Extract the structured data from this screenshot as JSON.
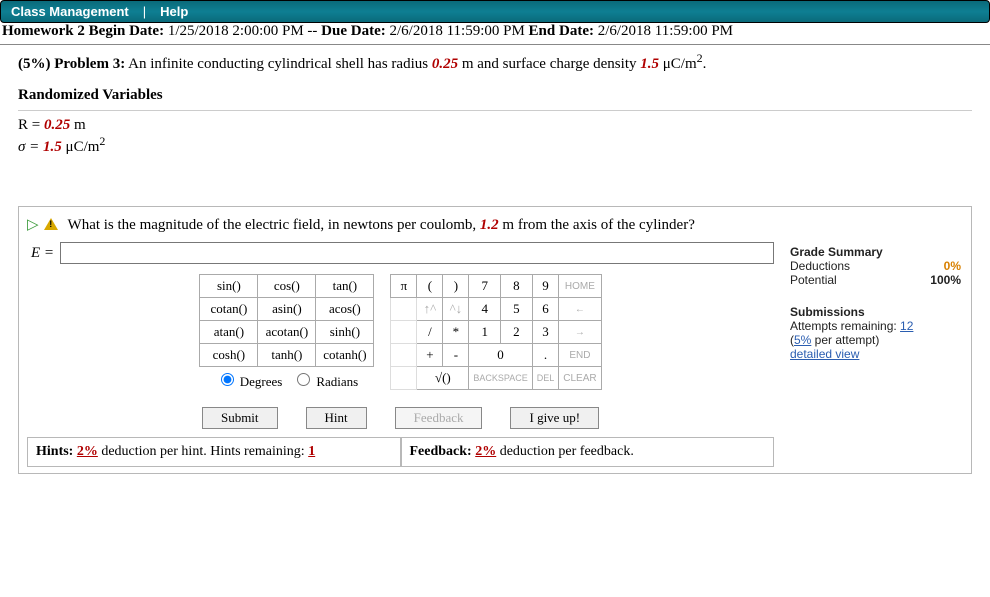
{
  "topbar": {
    "class_mgmt": "Class Management",
    "sep": "|",
    "help": "Help"
  },
  "dates": {
    "hw_label": "Homework 2",
    "begin_label": " Begin Date: ",
    "begin": "1/25/2018 2:00:00 PM",
    "dash": " -- ",
    "due_label": "Due Date: ",
    "due": "2/6/2018 11:59:00 PM ",
    "end_label": "End Date: ",
    "end": "2/6/2018 11:59:00 PM"
  },
  "problem": {
    "weight": "(5%) ",
    "label": "Problem 3:",
    "text1": " An infinite conducting cylindrical shell has radius ",
    "r": "0.25",
    "text2": " m and surface charge density ",
    "sigma": "1.5",
    "text3": " μC/m",
    "text4": "."
  },
  "rand_header": "Randomized Variables",
  "vars": {
    "r_lhs": "R = ",
    "r_val": "0.25",
    "r_unit": " m",
    "s_lhs": "σ = ",
    "s_val": "1.5",
    "s_unit": " μC/m"
  },
  "question": {
    "text1": "What is the magnitude of the electric field, in newtons per coulomb, ",
    "dist": "1.2",
    "text2": " m from the axis of the cylinder?"
  },
  "answer_label": "E = ",
  "fn": {
    "r0c0": "sin()",
    "r0c1": "cos()",
    "r0c2": "tan()",
    "r1c0": "cotan()",
    "r1c1": "asin()",
    "r1c2": "acos()",
    "r2c0": "atan()",
    "r2c1": "acotan()",
    "r2c2": "sinh()",
    "r3c0": "cosh()",
    "r3c1": "tanh()",
    "r3c2": "cotanh()",
    "deg": "Degrees",
    "rad": "Radians"
  },
  "num": {
    "pi": "π",
    "lp": "(",
    "rp": ")",
    "7": "7",
    "8": "8",
    "9": "9",
    "home": "HOME",
    "up": "↑^",
    "dn": "^↓",
    "4": "4",
    "5": "5",
    "6": "6",
    "left": "←",
    "sl": "/",
    "st": "*",
    "1": "1",
    "2": "2",
    "3": "3",
    "right": "→",
    "pl": "+",
    "mi": "-",
    "0": "0",
    "dot": ".",
    "end": "END",
    "sqrt": "√()",
    "bksp": "BACKSPACE",
    "del": "DEL",
    "clear": "CLEAR"
  },
  "actions": {
    "submit": "Submit",
    "hint": "Hint",
    "feedback": "Feedback",
    "giveup": "I give up!"
  },
  "footer": {
    "hints_pre": "Hints: ",
    "hints_pct": "2%",
    "hints_mid": " deduction per hint. Hints remaining: ",
    "hints_rem": "1",
    "fb_pre": "Feedback: ",
    "fb_pct": "2%",
    "fb_post": " deduction per feedback."
  },
  "side": {
    "grade_head": "Grade Summary",
    "ded_label": "Deductions",
    "ded_val": "0%",
    "pot_label": "Potential",
    "pot_val": "100%",
    "sub_head": "Submissions",
    "att_pre": "Attempts remaining: ",
    "att_val": "12",
    "per_pre": "(",
    "per_pct": "5%",
    "per_post": " per attempt)",
    "detail": "detailed view"
  }
}
